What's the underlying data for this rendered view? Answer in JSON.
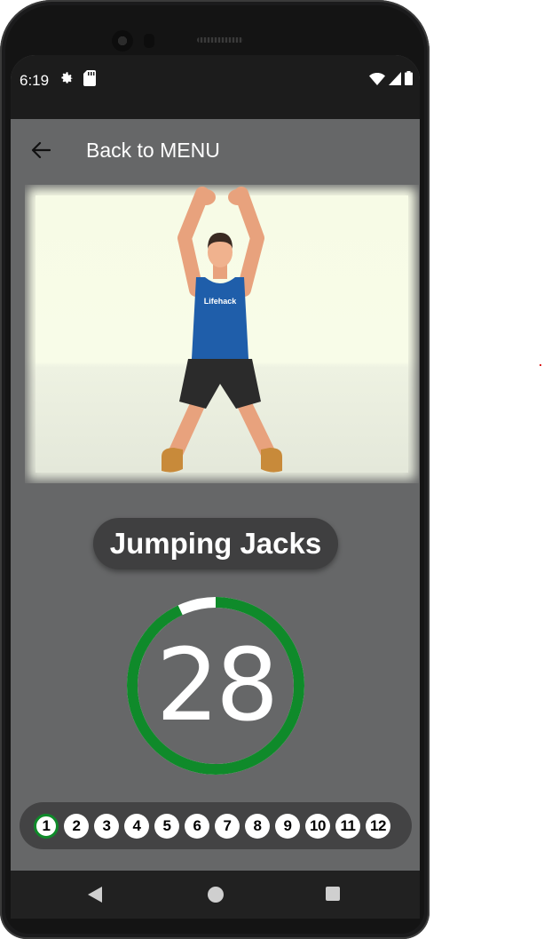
{
  "status_bar": {
    "time": "6:19",
    "icons": [
      "gear-icon",
      "sd-card-icon",
      "wifi-icon",
      "cell-signal-icon",
      "battery-icon"
    ]
  },
  "app_bar": {
    "back_icon": "arrow-left-icon",
    "title": "Back to MENU"
  },
  "exercise": {
    "name": "Jumping Jacks",
    "shirt_text": "Lifehack"
  },
  "timer": {
    "value": "28",
    "progress": 0.93,
    "colors": {
      "ring": "#0f8a2a",
      "remaining": "#ffffff"
    }
  },
  "steps": {
    "items": [
      "1",
      "2",
      "3",
      "4",
      "5",
      "6",
      "7",
      "8",
      "9",
      "10",
      "11",
      "12"
    ],
    "active": "1",
    "active_color": "#0f8a2a"
  },
  "nav": {
    "icons": [
      "back-triangle-icon",
      "home-circle-icon",
      "recents-square-icon"
    ]
  }
}
